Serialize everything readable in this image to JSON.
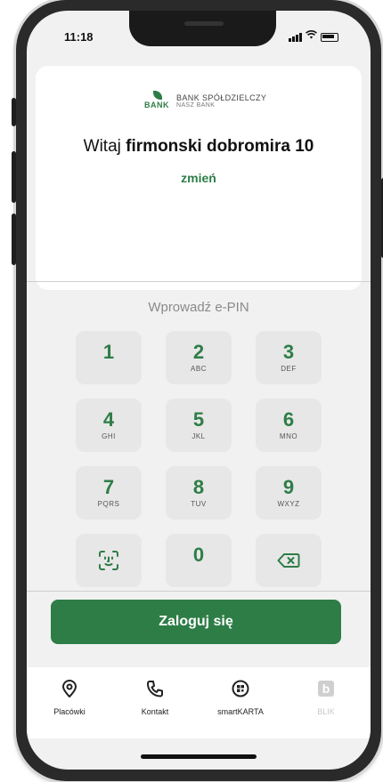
{
  "status_bar": {
    "time": "11:18"
  },
  "brand": {
    "logo_text": "BANK",
    "name": "BANK SPÓŁDZIELCZY",
    "subtitle": "NASZ BANK"
  },
  "greeting": {
    "prefix": "Witaj",
    "name": "firmonski dobromira 10",
    "change_link": "zmień"
  },
  "pin": {
    "prompt": "Wprowadź e-PIN"
  },
  "keypad": {
    "keys": [
      {
        "digit": "1",
        "letters": ""
      },
      {
        "digit": "2",
        "letters": "ABC"
      },
      {
        "digit": "3",
        "letters": "DEF"
      },
      {
        "digit": "4",
        "letters": "GHI"
      },
      {
        "digit": "5",
        "letters": "JKL"
      },
      {
        "digit": "6",
        "letters": "MNO"
      },
      {
        "digit": "7",
        "letters": "PQRS"
      },
      {
        "digit": "8",
        "letters": "TUV"
      },
      {
        "digit": "9",
        "letters": "WXYZ"
      },
      {
        "digit": "0",
        "letters": ""
      }
    ]
  },
  "login_button": {
    "label": "Zaloguj się"
  },
  "bottom_nav": {
    "items": [
      {
        "label": "Placówki",
        "icon": "location-pin-icon"
      },
      {
        "label": "Kontakt",
        "icon": "phone-icon"
      },
      {
        "label": "smartKARTA",
        "icon": "smart-card-icon"
      },
      {
        "label": "BLIK",
        "icon": "blik-icon"
      }
    ]
  },
  "colors": {
    "accent": "#2e7d47",
    "key_bg": "#e7e7e7",
    "screen_bg": "#f1f1f1"
  }
}
